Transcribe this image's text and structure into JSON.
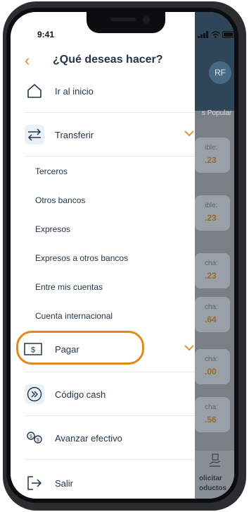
{
  "status_bar": {
    "time": "9:41"
  },
  "header": {
    "title": "¿Qué deseas hacer?"
  },
  "menu": {
    "home": "Ir al inicio",
    "transfer": "Transferir",
    "transfer_subitems": [
      "Terceros",
      "Otros bancos",
      "Expresos",
      "Expresos a otros bancos",
      "Entre mis cuentas",
      "Cuenta internacional"
    ],
    "pay": "Pagar",
    "cash_code": "Código cash",
    "advance": "Avanzar efectivo",
    "logout": "Salir"
  },
  "background": {
    "avatar": "RF",
    "popular": "s Popular",
    "cards": [
      {
        "label": "ible:",
        "value": ".23"
      },
      {
        "label": "ible:",
        "value": ".23"
      },
      {
        "label": "cha:",
        "value": ".23"
      },
      {
        "label": "cha:",
        "value": ".64"
      },
      {
        "label": "cha:",
        "value": ".00"
      },
      {
        "label": "cha:",
        "value": ".56"
      }
    ],
    "bottom_line1": "olicitar",
    "bottom_line2": "oductos"
  },
  "colors": {
    "accent": "#e08a1e",
    "text": "#23354a",
    "icon_bg": "#eaf1f9",
    "header_bg": "#2f4558"
  }
}
